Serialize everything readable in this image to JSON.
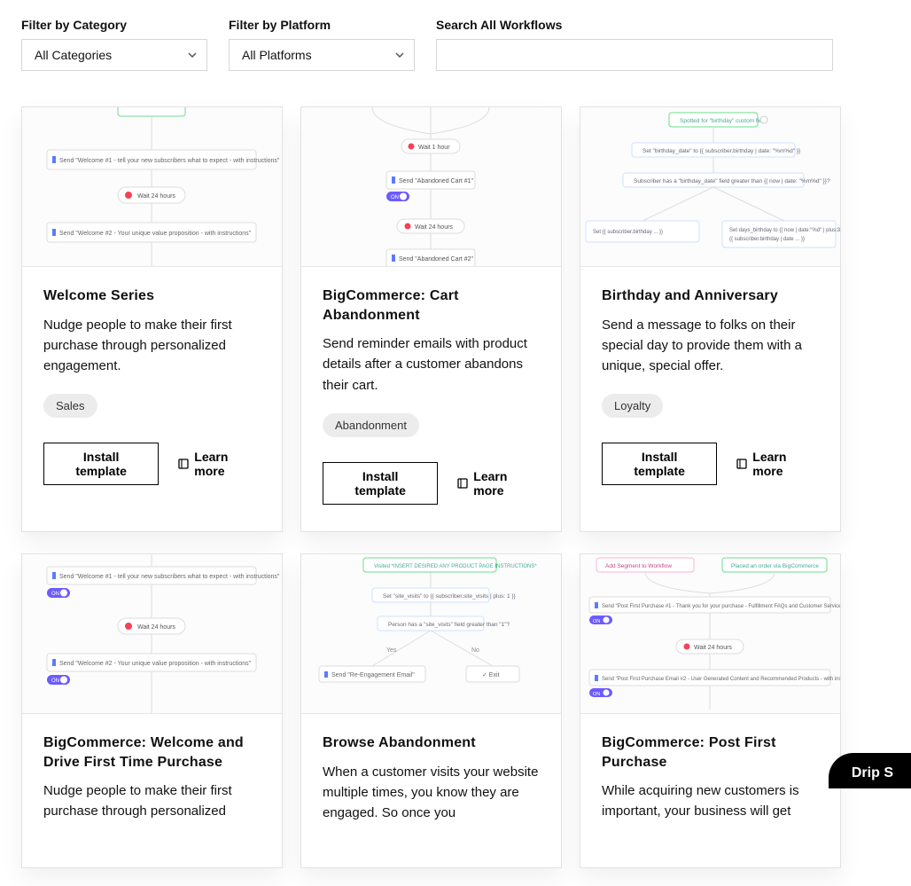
{
  "filters": {
    "category_label": "Filter by Category",
    "category_value": "All Categories",
    "platform_label": "Filter by Platform",
    "platform_value": "All Platforms",
    "search_label": "Search All Workflows",
    "search_value": ""
  },
  "labels": {
    "install": "Install template",
    "learn": "Learn more"
  },
  "cards": [
    {
      "title": "Welcome Series",
      "desc": "Nudge people to make their first purchase through personalized engagement.",
      "tag": "Sales"
    },
    {
      "title": "BigCommerce: Cart Abandonment",
      "desc": "Send reminder emails with product details after a customer abandons their cart.",
      "tag": "Abandonment"
    },
    {
      "title": "Birthday and Anniversary",
      "desc": "Send a message to folks on their special day to provide them with a unique, special offer.",
      "tag": "Loyalty"
    },
    {
      "title": "BigCommerce: Welcome and Drive First Time Purchase",
      "desc": "Nudge people to make their first purchase through personalized",
      "tag": ""
    },
    {
      "title": "Browse Abandonment",
      "desc": "When a customer visits your website multiple times, you know they are engaged. So once you",
      "tag": ""
    },
    {
      "title": "BigCommerce: Post First Purchase",
      "desc": "While acquiring new customers is important, your business will get",
      "tag": ""
    }
  ],
  "bubble": "Drip S"
}
